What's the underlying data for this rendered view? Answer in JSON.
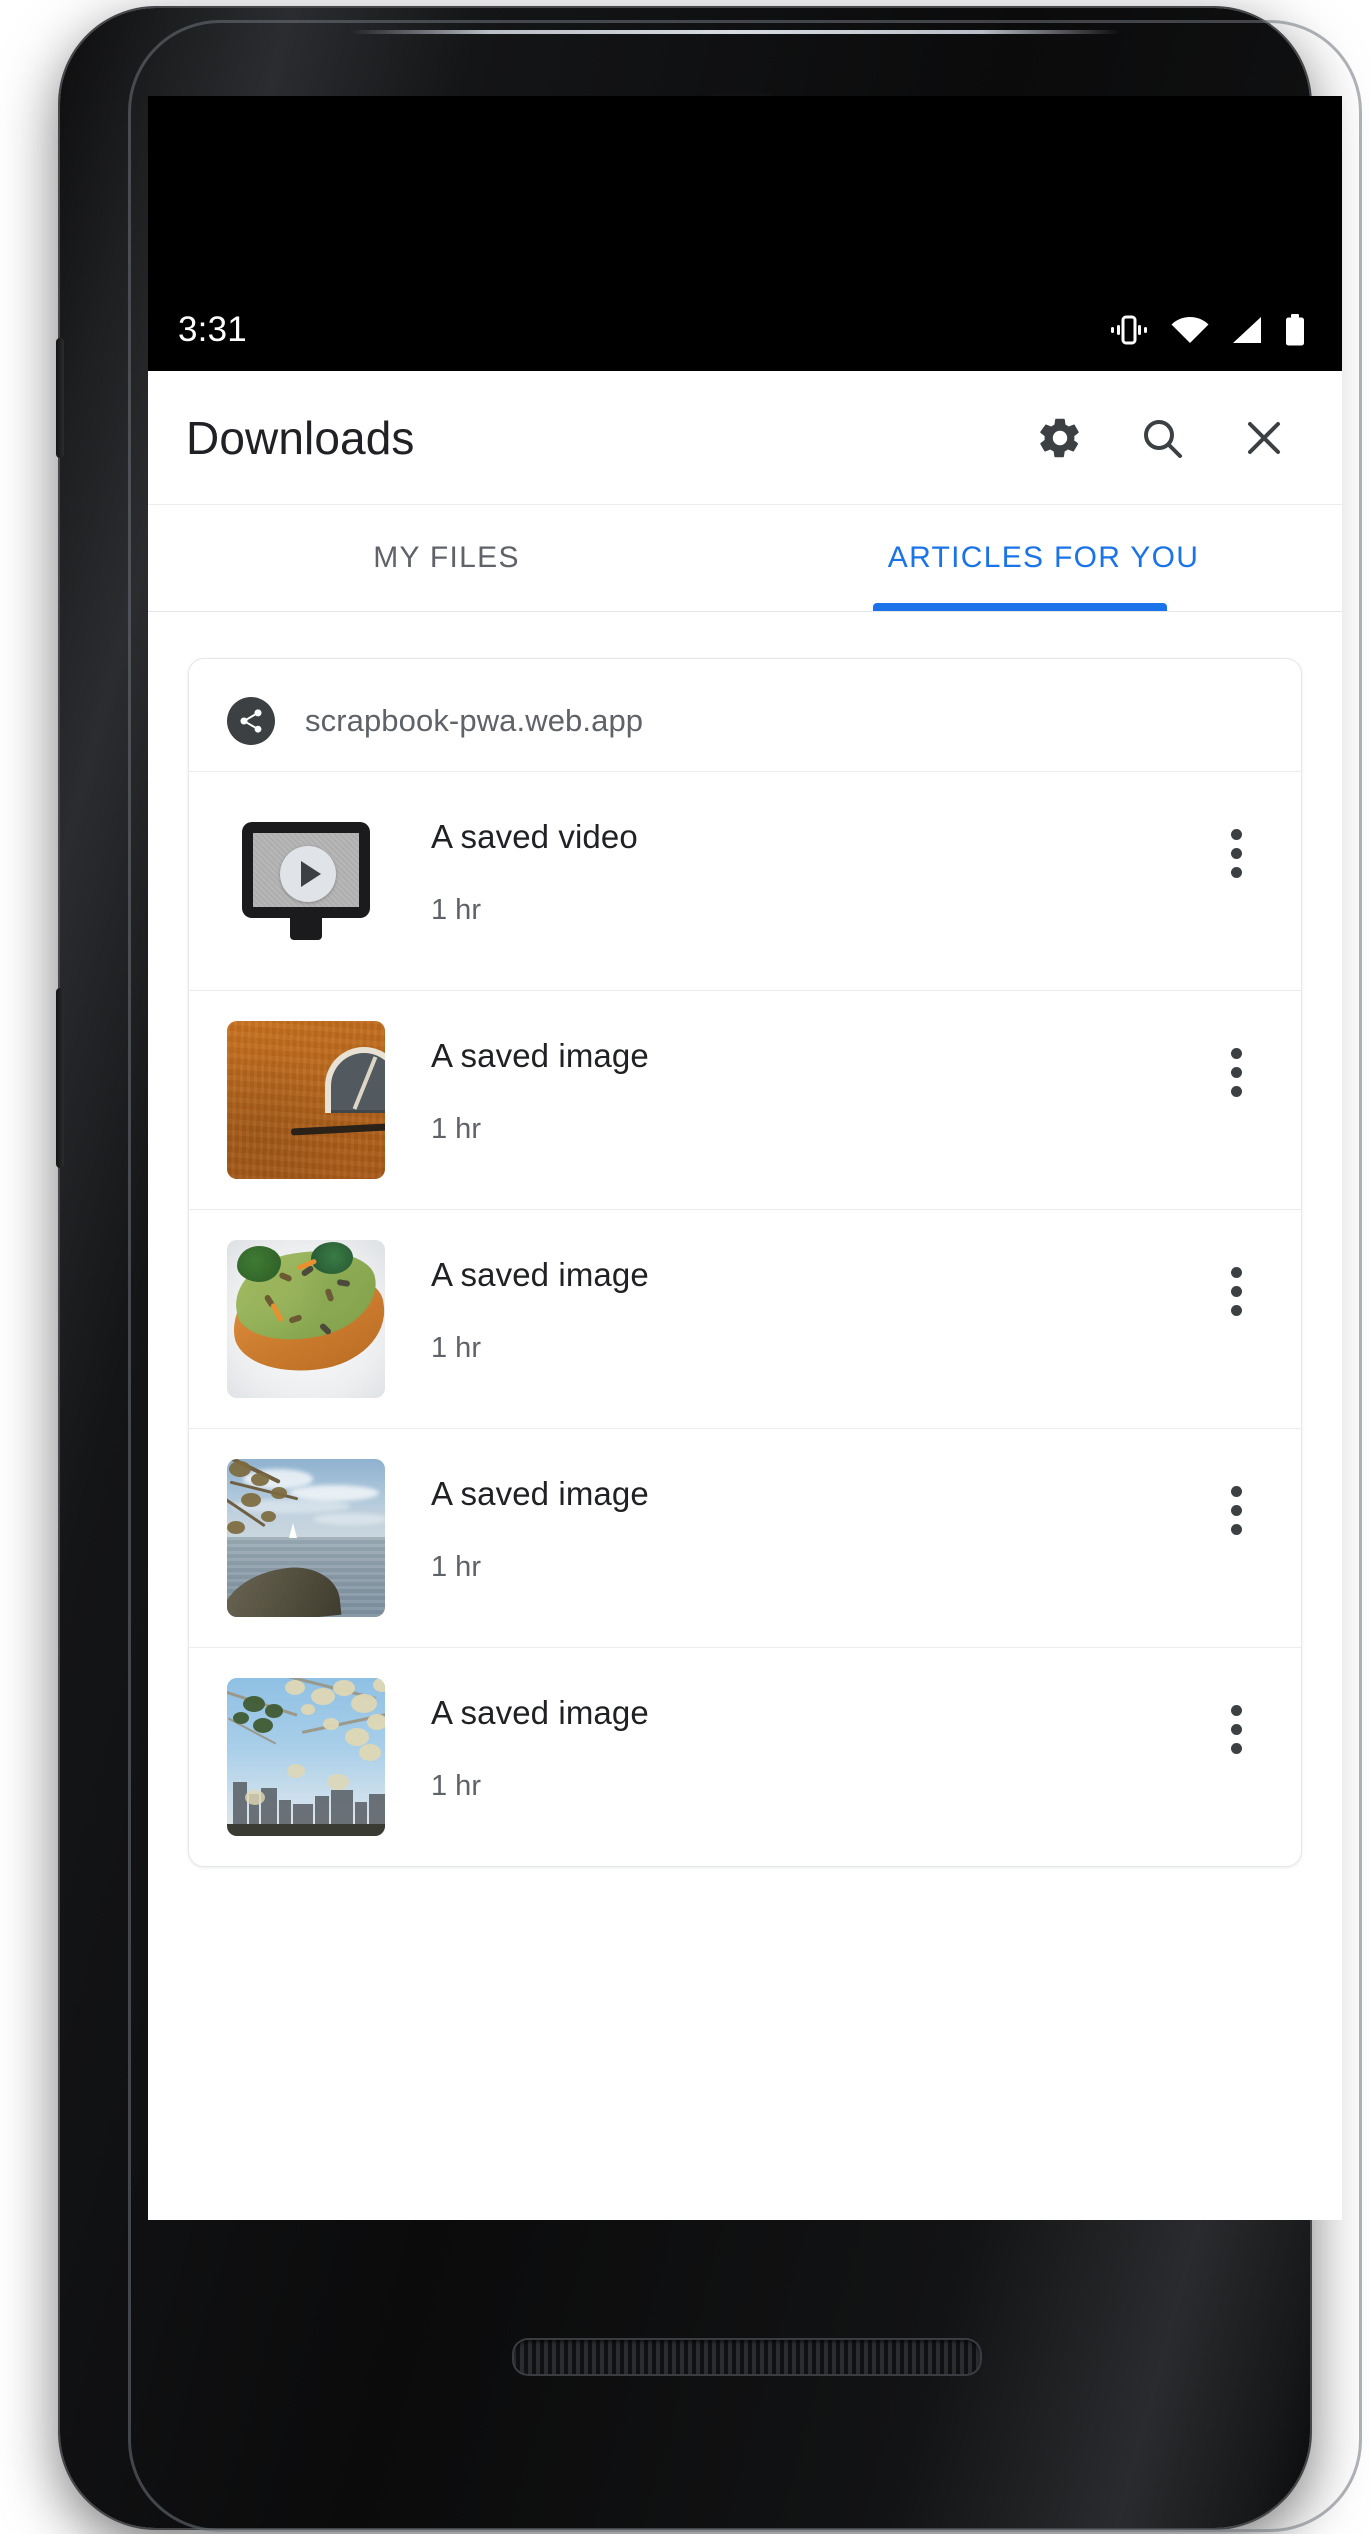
{
  "status_bar": {
    "clock": "3:31",
    "icons": [
      "vibrate-icon",
      "wifi-icon",
      "cell-signal-icon",
      "battery-icon"
    ]
  },
  "toolbar": {
    "title": "Downloads",
    "actions": [
      {
        "name": "settings-button",
        "icon": "gear-icon",
        "label": "Settings"
      },
      {
        "name": "search-button",
        "icon": "search-icon",
        "label": "Search"
      },
      {
        "name": "close-button",
        "icon": "close-icon",
        "label": "Close"
      }
    ]
  },
  "tabs": [
    {
      "label": "MY FILES",
      "active": false
    },
    {
      "label": "ARTICLES FOR YOU",
      "active": true
    }
  ],
  "accent_color": "#1a73e8",
  "card": {
    "origin": "scrapbook-pwa.web.app",
    "origin_icon": "share-icon",
    "rows": [
      {
        "title": "A saved video",
        "subtitle": "1 hr",
        "thumb": "video-placeholder-icon",
        "menu_icon": "overflow-menu-icon"
      },
      {
        "title": "A saved image",
        "subtitle": "1 hr",
        "thumb": "orange-wall-arched-window-photo",
        "menu_icon": "overflow-menu-icon"
      },
      {
        "title": "A saved image",
        "subtitle": "1 hr",
        "thumb": "avocado-toast-photo",
        "menu_icon": "overflow-menu-icon"
      },
      {
        "title": "A saved image",
        "subtitle": "1 hr",
        "thumb": "lake-sailboat-photo",
        "menu_icon": "overflow-menu-icon"
      },
      {
        "title": "A saved image",
        "subtitle": "1 hr",
        "thumb": "city-skyline-blossoms-photo",
        "menu_icon": "overflow-menu-icon"
      }
    ]
  }
}
